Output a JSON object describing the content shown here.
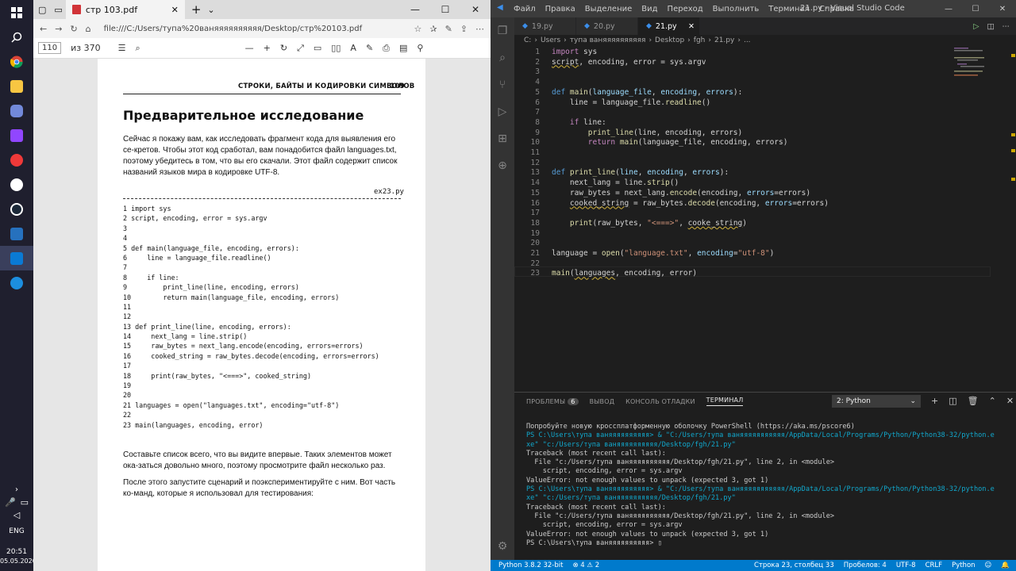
{
  "taskbar": {
    "items": [
      "start",
      "search",
      "chrome",
      "files",
      "discord",
      "twitch",
      "vivaldi",
      "github",
      "steam",
      "powershell",
      "vscode",
      "edge"
    ],
    "lang": "ENG",
    "time": "20:51",
    "date": "05.05.2020"
  },
  "edge": {
    "tab_title": "стр 103.pdf",
    "new_tab": "+",
    "url": "file:///C:/Users/тупа%20ваняяяяяяяяяя/Desktop/стр%20103.pdf",
    "page_current": "110",
    "page_total": "из 370",
    "pdf": {
      "header": "СТРОКИ, БАЙТЫ И КОДИРОВКИ СИМВОЛОВ",
      "page_number": "109",
      "section": "Предварительное исследование",
      "p1": "Сейчас я покажу вам, как исследовать фрагмент кода для выявления его се-кретов. Чтобы этот код сработал, вам понадобится файл languages.txt, поэтому убедитесь в том, что вы его скачали. Этот файл содержит список названий языков мира в кодировке UTF-8.",
      "filename": "ex23.py",
      "code": [
        "1 import sys",
        "2 script, encoding, error = sys.argv",
        "3",
        "4",
        "5 def main(language_file, encoding, errors):",
        "6     line = language_file.readline()",
        "7",
        "8     if line:",
        "9         print_line(line, encoding, errors)",
        "10        return main(language_file, encoding, errors)",
        "11",
        "12",
        "13 def print_line(line, encoding, errors):",
        "14     next_lang = line.strip()",
        "15     raw_bytes = next_lang.encode(encoding, errors=errors)",
        "16     cooked_string = raw_bytes.decode(encoding, errors=errors)",
        "17",
        "18     print(raw_bytes, \"<===>\", cooked_string)",
        "19",
        "20",
        "21 languages = open(\"languages.txt\", encoding=\"utf-8\")",
        "22",
        "23 main(languages, encoding, error)"
      ],
      "p2": "Составьте список всего, что вы видите впервые. Таких элементов может ока-заться довольно много, поэтому просмотрите файл несколько раз.",
      "p3": "После этого запустите сценарий и поэкспериментируйте с ним. Вот часть ко-манд, которые я использовал для тестирования:"
    }
  },
  "vscode": {
    "menu": [
      "Файл",
      "Правка",
      "Выделение",
      "Вид",
      "Переход",
      "Выполнить",
      "Терминал",
      "Справка"
    ],
    "window_title": "21.py - Visual Studio Code",
    "tabs": [
      "19.py",
      "20.py",
      "21.py"
    ],
    "breadcrumb": [
      "C:",
      "Users",
      "тупа ваняяяяяяяяяя",
      "Desktop",
      "fgh",
      "21.py",
      "..."
    ],
    "panel_tabs": {
      "problems": "ПРОБЛЕМЫ",
      "problems_count": "6",
      "output": "ВЫВОД",
      "debug": "КОНСОЛЬ ОТЛАДКИ",
      "terminal": "ТЕРМИНАЛ"
    },
    "terminal_select": "2: Python",
    "terminal": [
      "Попробуйте новую кроссплатформенную оболочку PowerShell (https://aka.ms/pscore6)",
      "",
      "PS C:\\Users\\тупа ваняяяяяяяяяя> & \"C:/Users/тупа ваняяяяяяяяяяя/AppData/Local/Programs/Python/Python38-32/python.e",
      "xe\" \"c:/Users/тупа ваняяяяяяяяяя/Desktop/fgh/21.py\"",
      "Traceback (most recent call last):",
      "  File \"c:/Users/тупа ваняяяяяяяяяя/Desktop/fgh/21.py\", line 2, in <module>",
      "    script, encoding, error = sys.argv",
      "ValueError: not enough values to unpack (expected 3, got 1)",
      "PS C:\\Users\\тупа ваняяяяяяяяяя> & \"C:/Users/тупа ваняяяяяяяяяяя/AppData/Local/Programs/Python/Python38-32/python.e",
      "xe\" \"c:/Users/тупа ваняяяяяяяяяя/Desktop/fgh/21.py\"",
      "Traceback (most recent call last):",
      "  File \"c:/Users/тупа ваняяяяяяяяяя/Desktop/fgh/21.py\", line 2, in <module>",
      "    script, encoding, error = sys.argv",
      "ValueError: not enough values to unpack (expected 3, got 1)",
      "PS C:\\Users\\тупа ваняяяяяяяяяя> "
    ],
    "status": {
      "python": "Python 3.8.2 32-bit",
      "errors": "4",
      "warnings": "2",
      "position": "Строка 23, столбец 33",
      "spaces": "Пробелов: 4",
      "encoding": "UTF-8",
      "eol": "CRLF",
      "language": "Python"
    },
    "accent": "#007acc"
  }
}
